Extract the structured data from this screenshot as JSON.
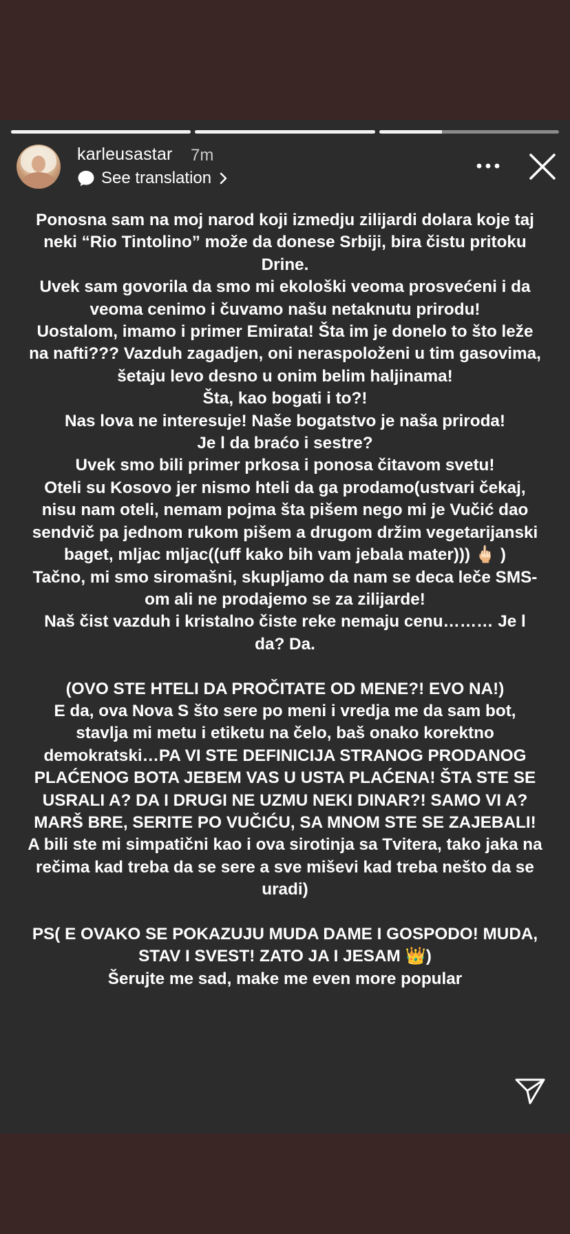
{
  "header": {
    "username": "karleusastar",
    "time_ago": "7m",
    "translation_label": "See translation"
  },
  "progress": {
    "segments": [
      1.0,
      1.0,
      0.35
    ]
  },
  "icons": {
    "avatar": "profile-picture",
    "translate": "speech-bubble-icon",
    "translate_chevron": "chevron-right-icon",
    "more": "more-dots-icon",
    "close": "close-icon",
    "send": "send-icon"
  },
  "colors": {
    "story_background": "#2c2c2c",
    "outer_background": "#3a2725",
    "text": "#ffffff"
  },
  "story": {
    "text": "Ponosna sam na moj narod koji izmedju zilijardi dolara koje taj neki “Rio Tintolino” može da donese Srbiji, bira čistu pritoku Drine.\nUvek sam govorila da smo mi ekološki veoma prosvećeni i da veoma cenimo i čuvamo našu netaknutu prirodu!\nUostalom, imamo i primer Emirata! Šta im je donelo to što leže na nafti??? Vazduh zagadjen, oni neraspoloženi u tim  gasovima, šetaju levo desno u onim belim haljinama!\nŠta, kao bogati i to?!\nNas lova ne interesuje! Naše bogatstvo je naša priroda!\nJe l da braćo i sestre?\nUvek smo bili primer prkosa i ponosa čitavom svetu!\nOteli su Kosovo jer nismo hteli da ga prodamo(ustvari čekaj, nisu nam oteli, nemam pojma šta pišem nego mi je Vučić dao sendvič pa jednom rukom pišem a drugom držim vegetarijanski baget, mljac mljac((uff kako bih vam jebala mater))) 🖕🏻 )\nTačno, mi smo siromašni, skupljamo da nam se deca leče SMS-om ali ne prodajemo se za zilijarde!\nNaš čist vazduh i kristalno čiste reke nemaju cenu……… Je l da? Da.\n\n(OVO STE HTELI DA PROČITATE OD MENE?! EVO NA!)\nE da, ova Nova S što sere po meni i vredja me da sam bot, stavlja mi metu i etiketu na čelo, baš onako korektno demokratski…PA VI STE DEFINICIJA STRANOG PRODANOG PLAĆENOG BOTA JEBEM VAS U USTA PLAĆENA! ŠTA STE SE USRALI A? DA I DRUGI NE UZMU NEKI DINAR?! SAMO VI A? MARŠ BRE, SERITE PO VUČIĆU, SA MNOM STE SE ZAJEBALI! A bili ste mi simpatični kao i ova sirotinja sa Tvitera, tako jaka na rečima kad treba da se sere a sve miševi kad treba nešto da se uradi)\n\nPS( E OVAKO SE POKAZUJU MUDA DAME I GOSPODO! MUDA, STAV I SVEST!  ZATO JA I JESAM 👑)\nŠerujte me sad, make me even more popular"
  }
}
